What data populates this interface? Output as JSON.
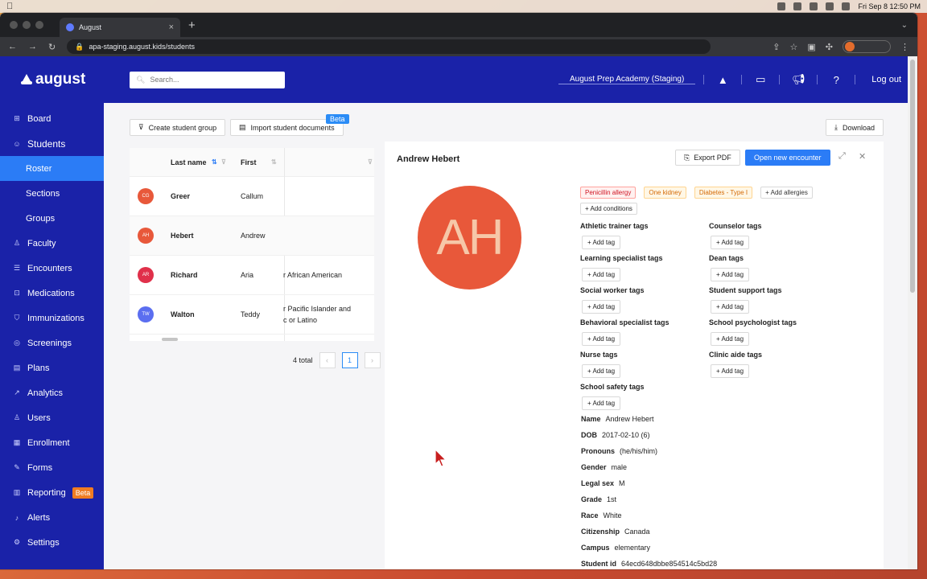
{
  "menubar": {
    "clock": "Fri Sep 8  12:50 PM"
  },
  "browser": {
    "tab_title": "August",
    "url": "apa-staging.august.kids/students"
  },
  "app": {
    "logo": "august",
    "search_placeholder": "Search...",
    "school": "August Prep Academy (Staging)",
    "logout": "Log out"
  },
  "sidebar": {
    "items": [
      {
        "label": "Board",
        "icon": "board-icon"
      },
      {
        "label": "Students",
        "icon": "students-icon"
      },
      {
        "label": "Roster"
      },
      {
        "label": "Sections"
      },
      {
        "label": "Groups"
      },
      {
        "label": "Faculty",
        "icon": "faculty-icon"
      },
      {
        "label": "Encounters",
        "icon": "encounters-icon"
      },
      {
        "label": "Medications",
        "icon": "medications-icon"
      },
      {
        "label": "Immunizations",
        "icon": "immunizations-icon"
      },
      {
        "label": "Screenings",
        "icon": "screenings-icon"
      },
      {
        "label": "Plans",
        "icon": "plans-icon"
      },
      {
        "label": "Analytics",
        "icon": "analytics-icon"
      },
      {
        "label": "Users",
        "icon": "users-icon"
      },
      {
        "label": "Enrollment",
        "icon": "enrollment-icon"
      },
      {
        "label": "Forms",
        "icon": "forms-icon"
      },
      {
        "label": "Reporting",
        "icon": "reporting-icon"
      },
      {
        "label": "Alerts",
        "icon": "alerts-icon"
      },
      {
        "label": "Settings",
        "icon": "settings-icon"
      }
    ],
    "reporting_badge": "Beta"
  },
  "toolbar": {
    "create_group": "Create student group",
    "import_docs": "Import student documents",
    "beta": "Beta",
    "download": "Download"
  },
  "table": {
    "headers": {
      "last": "Last name",
      "first": "First"
    },
    "rows": [
      {
        "initials": "CG",
        "last": "Greer",
        "first": "Callum",
        "race": ""
      },
      {
        "initials": "AH",
        "last": "Hebert",
        "first": "Andrew",
        "race": ""
      },
      {
        "initials": "AR",
        "last": "Richard",
        "first": "Aria",
        "race": "r African American"
      },
      {
        "initials": "TW",
        "last": "Walton",
        "first": "Teddy",
        "race": "r Pacific Islander and\nc or Latino"
      }
    ],
    "avatar_colors": [
      "#e8583a",
      "#e8583a",
      "#e0304a",
      "#5b6ef0"
    ],
    "total": "4 total",
    "page": "1"
  },
  "panel": {
    "title": "Andrew Hebert",
    "export_pdf": "Export PDF",
    "open_encounter": "Open new encounter",
    "initials": "AH",
    "allergies": [
      "Penicillin allergy",
      "One kidney",
      "Diabetes - Type I"
    ],
    "add_allergies": "Add allergies",
    "add_conditions": "Add conditions",
    "add_tag": "Add tag",
    "tag_groups_left": [
      "Athletic trainer tags",
      "Learning specialist tags",
      "Social worker tags",
      "Behavioral specialist tags",
      "Nurse tags",
      "School safety tags"
    ],
    "tag_groups_right": [
      "Counselor tags",
      "Dean tags",
      "Student support tags",
      "School psychologist tags",
      "Clinic aide tags"
    ],
    "info": [
      {
        "label": "Name",
        "value": "Andrew Hebert"
      },
      {
        "label": "DOB",
        "value": "2017-02-10 (6)"
      },
      {
        "label": "Pronouns",
        "value": "(he/his/him)"
      },
      {
        "label": "Gender",
        "value": "male"
      },
      {
        "label": "Legal sex",
        "value": "M"
      },
      {
        "label": "Grade",
        "value": "1st"
      },
      {
        "label": "Race",
        "value": "White"
      },
      {
        "label": "Citizenship",
        "value": "Canada"
      },
      {
        "label": "Campus",
        "value": "elementary"
      },
      {
        "label": "Student id",
        "value": "64ecd648dbbe854514c5bd28"
      }
    ]
  },
  "colors": {
    "nav": "#1a22a8",
    "accent": "#2b7cf6",
    "beta": "#f07c22"
  }
}
